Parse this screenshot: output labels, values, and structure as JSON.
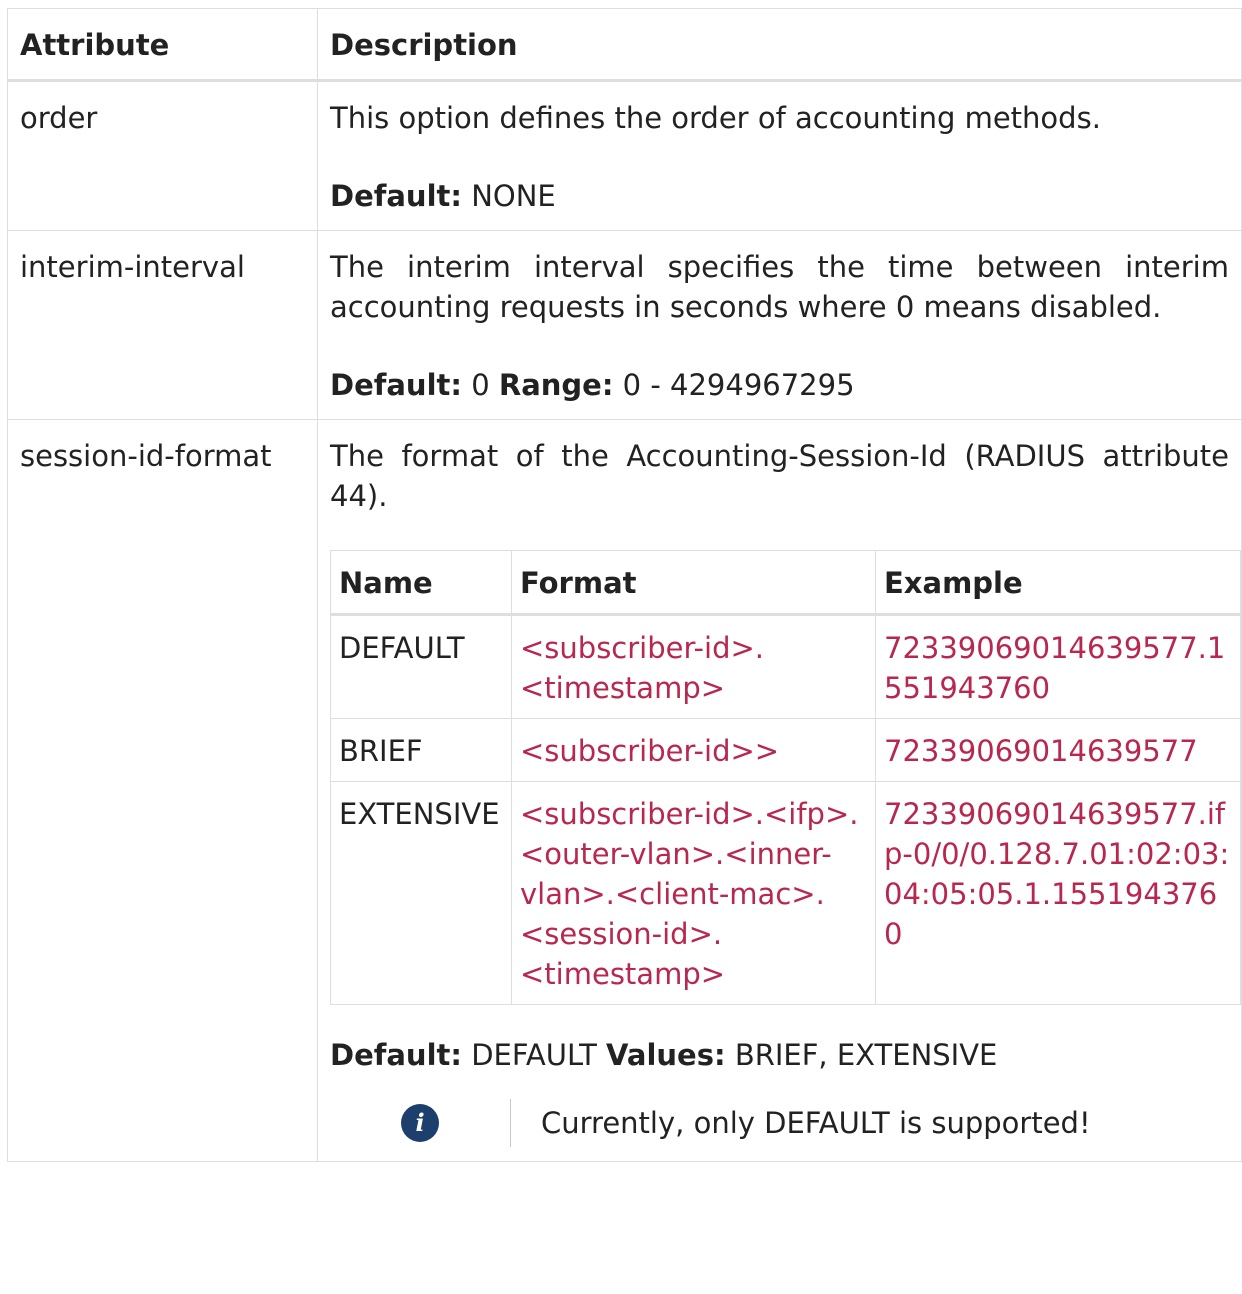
{
  "table": {
    "headers": {
      "attribute": "Attribute",
      "description": "Description"
    },
    "rows": [
      {
        "name": "order",
        "description": "This option defines the order of accounting methods.",
        "default_label": "Default:",
        "default_value": "NONE"
      },
      {
        "name": "interim-interval",
        "description": "The interim interval specifies the time between interim accounting requests in seconds where 0 means disabled.",
        "default_label": "Default:",
        "default_value": "0",
        "range_label": "Range:",
        "range_value": "0 - 4294967295"
      },
      {
        "name": "session-id-format",
        "description": "The format of the Accounting-Session-Id (RADIUS attribute 44).",
        "default_label": "Default:",
        "default_value": "DEFAULT",
        "values_label": "Values:",
        "values_value": "BRIEF, EXTENSIVE",
        "note": {
          "icon": "info-icon",
          "text": "Currently, only DEFAULT is supported!"
        },
        "format_table": {
          "headers": {
            "name": "Name",
            "format": "Format",
            "example": "Example"
          },
          "rows": [
            {
              "name": "DEFAULT",
              "format": "<subscriber-id>.<timestamp>",
              "example": "72339069014639577.1551943760"
            },
            {
              "name": "BRIEF",
              "format": "<subscriber-id>>",
              "example": "72339069014639577"
            },
            {
              "name": "EXTENSIVE",
              "format": "<subscriber-id>.<ifp>.<outer-vlan>.<inner-vlan>.<client-mac>.<session-id>.<timestamp>",
              "example": "72339069014639577.ifp-0/0/0.128.7.01:02:03:04:05:05.1.1551943760"
            }
          ]
        }
      }
    ]
  }
}
